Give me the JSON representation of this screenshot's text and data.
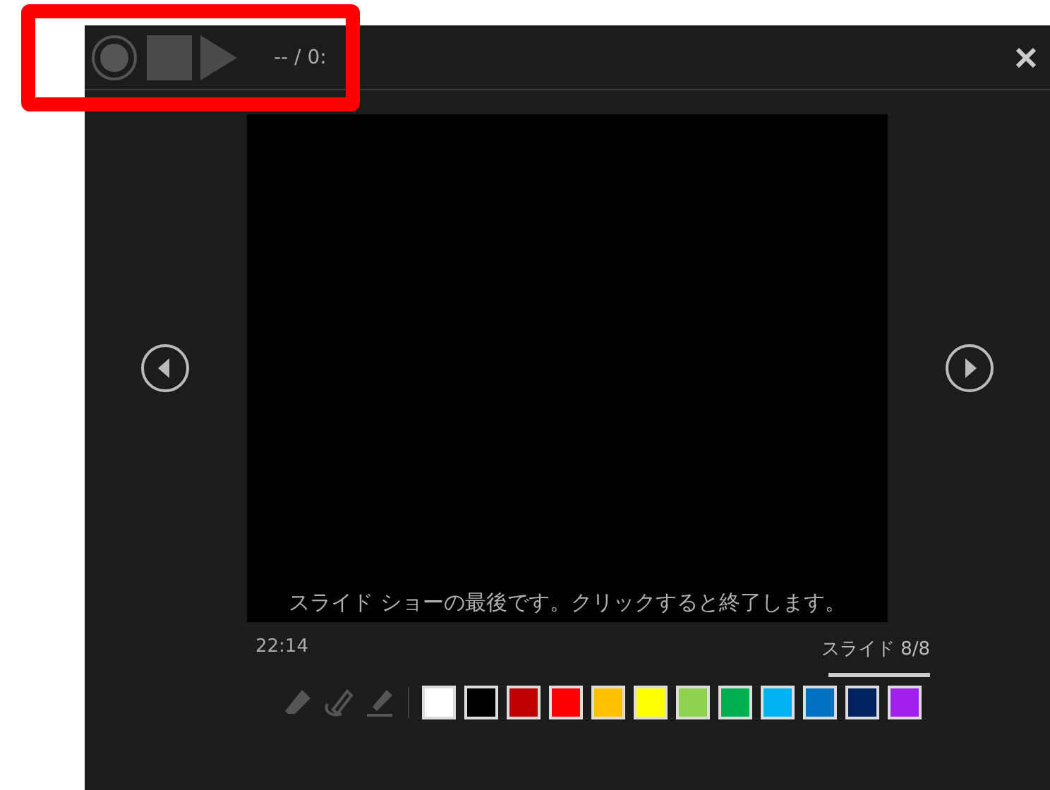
{
  "recording_bar": {
    "time": "-- / 0:"
  },
  "slide": {
    "caption": "スライド ショーの最後です。クリックすると終了します。"
  },
  "footer": {
    "clock": "22:14",
    "slide_counter": "スライド 8/8",
    "progress": {
      "level": 1
    }
  },
  "pen_colors": [
    {
      "color": "#ffffff"
    },
    {
      "color": "#000000"
    },
    {
      "color": "#c00000"
    },
    {
      "color": "#ff0000"
    },
    {
      "color": "#ffc000"
    },
    {
      "color": "#ffff00"
    },
    {
      "color": "#92d050"
    },
    {
      "color": "#00b050"
    },
    {
      "color": "#00b0f0"
    },
    {
      "color": "#0070c0"
    },
    {
      "color": "#002060"
    },
    {
      "color": "#a020f0"
    }
  ]
}
